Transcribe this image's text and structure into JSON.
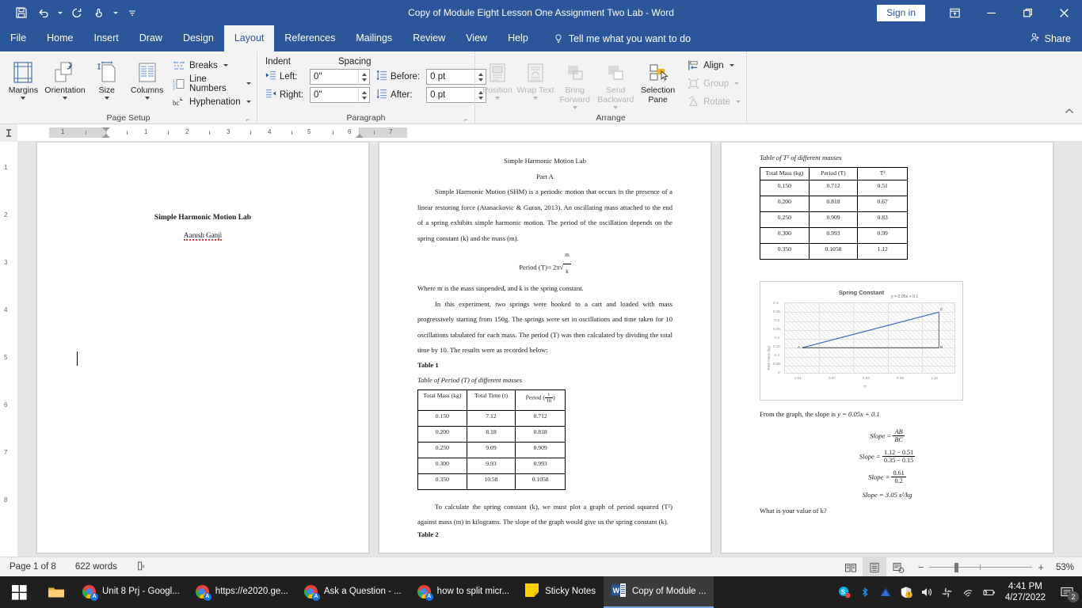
{
  "titlebar": {
    "document_title": "Copy of Module Eight Lesson One Assignment Two Lab  -  Word",
    "signin_label": "Sign in",
    "quick_access": [
      "save-icon",
      "undo-icon",
      "redo-icon",
      "touch-mode-icon",
      "customize-qat-icon"
    ],
    "window_buttons": [
      "ribbon-display-options-icon",
      "minimize-icon",
      "restore-icon",
      "close-icon"
    ]
  },
  "tabs": [
    {
      "label": "File",
      "active": false
    },
    {
      "label": "Home",
      "active": false
    },
    {
      "label": "Insert",
      "active": false
    },
    {
      "label": "Draw",
      "active": false
    },
    {
      "label": "Design",
      "active": false
    },
    {
      "label": "Layout",
      "active": true
    },
    {
      "label": "References",
      "active": false
    },
    {
      "label": "Mailings",
      "active": false
    },
    {
      "label": "Review",
      "active": false
    },
    {
      "label": "View",
      "active": false
    },
    {
      "label": "Help",
      "active": false
    }
  ],
  "tellme": "Tell me what you want to do",
  "share_label": "Share",
  "ribbon": {
    "groups": [
      {
        "name": "Page Setup",
        "label": "Page Setup",
        "big_buttons": [
          {
            "label": "Margins",
            "icon": "margins-icon",
            "caret": true,
            "disabled": false
          },
          {
            "label": "Orientation",
            "icon": "orientation-icon",
            "caret": true,
            "disabled": false
          },
          {
            "label": "Size",
            "icon": "size-icon",
            "caret": true,
            "disabled": false
          },
          {
            "label": "Columns",
            "icon": "columns-icon",
            "caret": true,
            "disabled": false
          }
        ],
        "small_buttons": [
          {
            "label": "Breaks",
            "icon": "breaks-icon",
            "caret": true
          },
          {
            "label": "Line Numbers",
            "icon": "line-numbers-icon",
            "caret": true
          },
          {
            "label": "Hyphenation",
            "icon": "hyphenation-icon",
            "caret": true
          }
        ]
      },
      {
        "name": "Paragraph",
        "label": "Paragraph",
        "indent_header": "Indent",
        "spacing_header": "Spacing",
        "fields": [
          {
            "label": "Left:",
            "value": "0\"",
            "icon": "indent-left-icon"
          },
          {
            "label": "Right:",
            "value": "0\"",
            "icon": "indent-right-icon"
          },
          {
            "label": "Before:",
            "value": "0 pt",
            "icon": "spacing-before-icon"
          },
          {
            "label": "After:",
            "value": "0 pt",
            "icon": "spacing-after-icon"
          }
        ]
      },
      {
        "name": "Arrange",
        "label": "Arrange",
        "big_buttons": [
          {
            "label": "Position",
            "icon": "position-icon",
            "caret": true,
            "disabled": true
          },
          {
            "label": "Wrap Text",
            "icon": "wrap-text-icon",
            "caret": true,
            "disabled": true
          },
          {
            "label": "Bring Forward",
            "icon": "bring-forward-icon",
            "caret": true,
            "disabled": true
          },
          {
            "label": "Send Backward",
            "icon": "send-backward-icon",
            "caret": true,
            "disabled": true
          },
          {
            "label": "Selection Pane",
            "icon": "selection-pane-icon",
            "caret": false,
            "disabled": false
          }
        ],
        "small_buttons": [
          {
            "label": "Align",
            "icon": "align-icon",
            "caret": true,
            "disabled": false
          },
          {
            "label": "Group",
            "icon": "group-icon",
            "caret": true,
            "disabled": true
          },
          {
            "label": "Rotate",
            "icon": "rotate-icon",
            "caret": true,
            "disabled": true
          }
        ]
      }
    ]
  },
  "ruler": {
    "numbers": [
      "1",
      "1",
      "2",
      "3",
      "4",
      "5",
      "6",
      "7"
    ],
    "vertical_numbers": [
      "1",
      "2",
      "3",
      "4",
      "5",
      "6",
      "7",
      "8"
    ]
  },
  "document": {
    "page1": {
      "title": "Simple Harmonic Motion Lab",
      "author": "Aarush Ganji"
    },
    "page2": {
      "title": "Simple Harmonic Motion Lab",
      "section": "Part A",
      "para1": "Simple Harmonic Motion (SHM) is a periodic motion that occurs in the presence of a linear restoring force (Atanackovic & Guran, 2013). An oscillating mass attached to the end of a spring exhibits simple harmonic motion. The period of the oscillation depends on the spring constant (k) and the mass (m).",
      "formula_label": "Period (T)=",
      "formula_coeff": "2π√",
      "formula_num": "m",
      "formula_den": "k",
      "para2": "Where m is the mass suspended, and k is the spring constant.",
      "para3": "In this experiment, two springs were hooked to a cart and loaded with mass progressively starting from 150g. The springs were set in oscillations and time taken for 10 oscillations tabulated for each mass. The period (T) was then calculated by dividing the total time by 10. The results were as recorded below:",
      "table1_label": "Table 1",
      "table1_caption": "Table of Period (T) of different masses",
      "table1_headers": [
        "Total Mass (kg)",
        "Total Time (t)",
        "Period ("
      ],
      "table1_header3_num": "t",
      "table1_header3_den": "10",
      "table1_rows": [
        [
          "0.150",
          "7.12",
          "0.712"
        ],
        [
          "0.200",
          "8.18",
          "0.818"
        ],
        [
          "0.250",
          "9.09",
          "0.909"
        ],
        [
          "0.300",
          "9.93",
          "0.993"
        ],
        [
          "0.350",
          "10.58",
          "0.1058"
        ]
      ],
      "para4": "To calculate the spring constant (k), we must plot a graph of period squared (T²) against mass (m) in kilograms. The slope of the graph would give us the spring constant (k).",
      "table2_label": "Table 2"
    },
    "page3": {
      "table2_caption": "Table of T² of different masses",
      "table2_headers": [
        "Total Mass (kg)",
        "Period (T)",
        "T²"
      ],
      "table2_rows": [
        [
          "0.150",
          "0.712",
          "0.51"
        ],
        [
          "0.200",
          "0.818",
          "0.67"
        ],
        [
          "0.250",
          "0.909",
          "0.83"
        ],
        [
          "0.300",
          "0.993",
          "0.99"
        ],
        [
          "0.350",
          "0.1058",
          "1.12"
        ]
      ],
      "slope_intro": "From the graph, the slope is",
      "slope_intro_eq": "y = 0.05x + 0.1",
      "eq1_label": "Slope =",
      "eq1_num": "AB",
      "eq1_den": "BC",
      "eq2_label": "Slope =",
      "eq2_num": "1.12 − 0.51",
      "eq2_den": "0.35 − 0.15",
      "eq3_label": "Slope =",
      "eq3_num": "0.61",
      "eq3_den": "0.2",
      "eq4": "Slope = 3.05 s²/kg",
      "question": "What is your value of k?"
    }
  },
  "chart_data": {
    "type": "line",
    "title": "Spring Constant",
    "annotation": "y = 0.05x + 0.1",
    "xlabel": "T²",
    "ylabel": "Total mass (kg)",
    "x_tick_labels": [
      "0.51",
      "0.67",
      "0.83",
      "0.99",
      "1.12"
    ],
    "y_tick_labels": [
      "0",
      "0.05",
      "0.1",
      "0.15",
      "0.2",
      "0.25",
      "0.3",
      "0.35",
      "0.4"
    ],
    "ylim": [
      0,
      0.4
    ],
    "grid": true,
    "legend": "none",
    "series": [
      {
        "name": "Total mass (kg)",
        "color": "#4472c4",
        "x": [
          0.51,
          0.67,
          0.83,
          0.99,
          1.12
        ],
        "values": [
          0.15,
          0.2,
          0.25,
          0.3,
          0.35
        ]
      },
      {
        "name": "AB construction line",
        "color": "#404040",
        "x": [
          0.51,
          1.12
        ],
        "values": [
          0.15,
          0.15
        ]
      },
      {
        "name": "BC construction line",
        "color": "#4472c4",
        "x": [
          1.12,
          1.12
        ],
        "values": [
          0.15,
          0.35
        ]
      }
    ],
    "point_labels": [
      {
        "text": "A",
        "x": 0.51,
        "y": 0.15
      },
      {
        "text": "B",
        "x": 1.12,
        "y": 0.15
      },
      {
        "text": "C",
        "x": 1.12,
        "y": 0.355
      }
    ]
  },
  "statusbar": {
    "page_indicator": "Page 1 of 8",
    "word_count": "622 words",
    "proofing_icon": "proofing-errors-icon",
    "views": [
      {
        "name": "read-mode",
        "active": false
      },
      {
        "name": "print-layout",
        "active": true
      },
      {
        "name": "web-layout",
        "active": false
      }
    ],
    "zoom_out": "−",
    "zoom_in": "+",
    "zoom_level": "53%"
  },
  "taskbar": {
    "start": "windows-start-icon",
    "pinned": [
      {
        "name": "file-explorer-icon"
      }
    ],
    "tasks": [
      {
        "label": "Unit 8 Prj - Googl...",
        "icon": "chrome-icon",
        "active": false
      },
      {
        "label": "https://e2020.ge...",
        "icon": "chrome-icon",
        "active": false
      },
      {
        "label": "Ask a Question - ...",
        "icon": "chrome-icon",
        "active": false
      },
      {
        "label": "how to split micr...",
        "icon": "chrome-icon",
        "active": false
      },
      {
        "label": "Sticky Notes",
        "icon": "sticky-notes-icon",
        "active": false
      },
      {
        "label": "Copy of Module ...",
        "icon": "word-icon",
        "active": true
      }
    ],
    "tray": [
      "skype-icon",
      "bluetooth-icon",
      "kaspersky-icon",
      "security-warning-icon",
      "volume-icon",
      "slack-icon",
      "wifi-icon",
      "battery-icon"
    ],
    "clock_time": "4:41 PM",
    "clock_date": "4/27/2022",
    "notification_count": "2"
  }
}
